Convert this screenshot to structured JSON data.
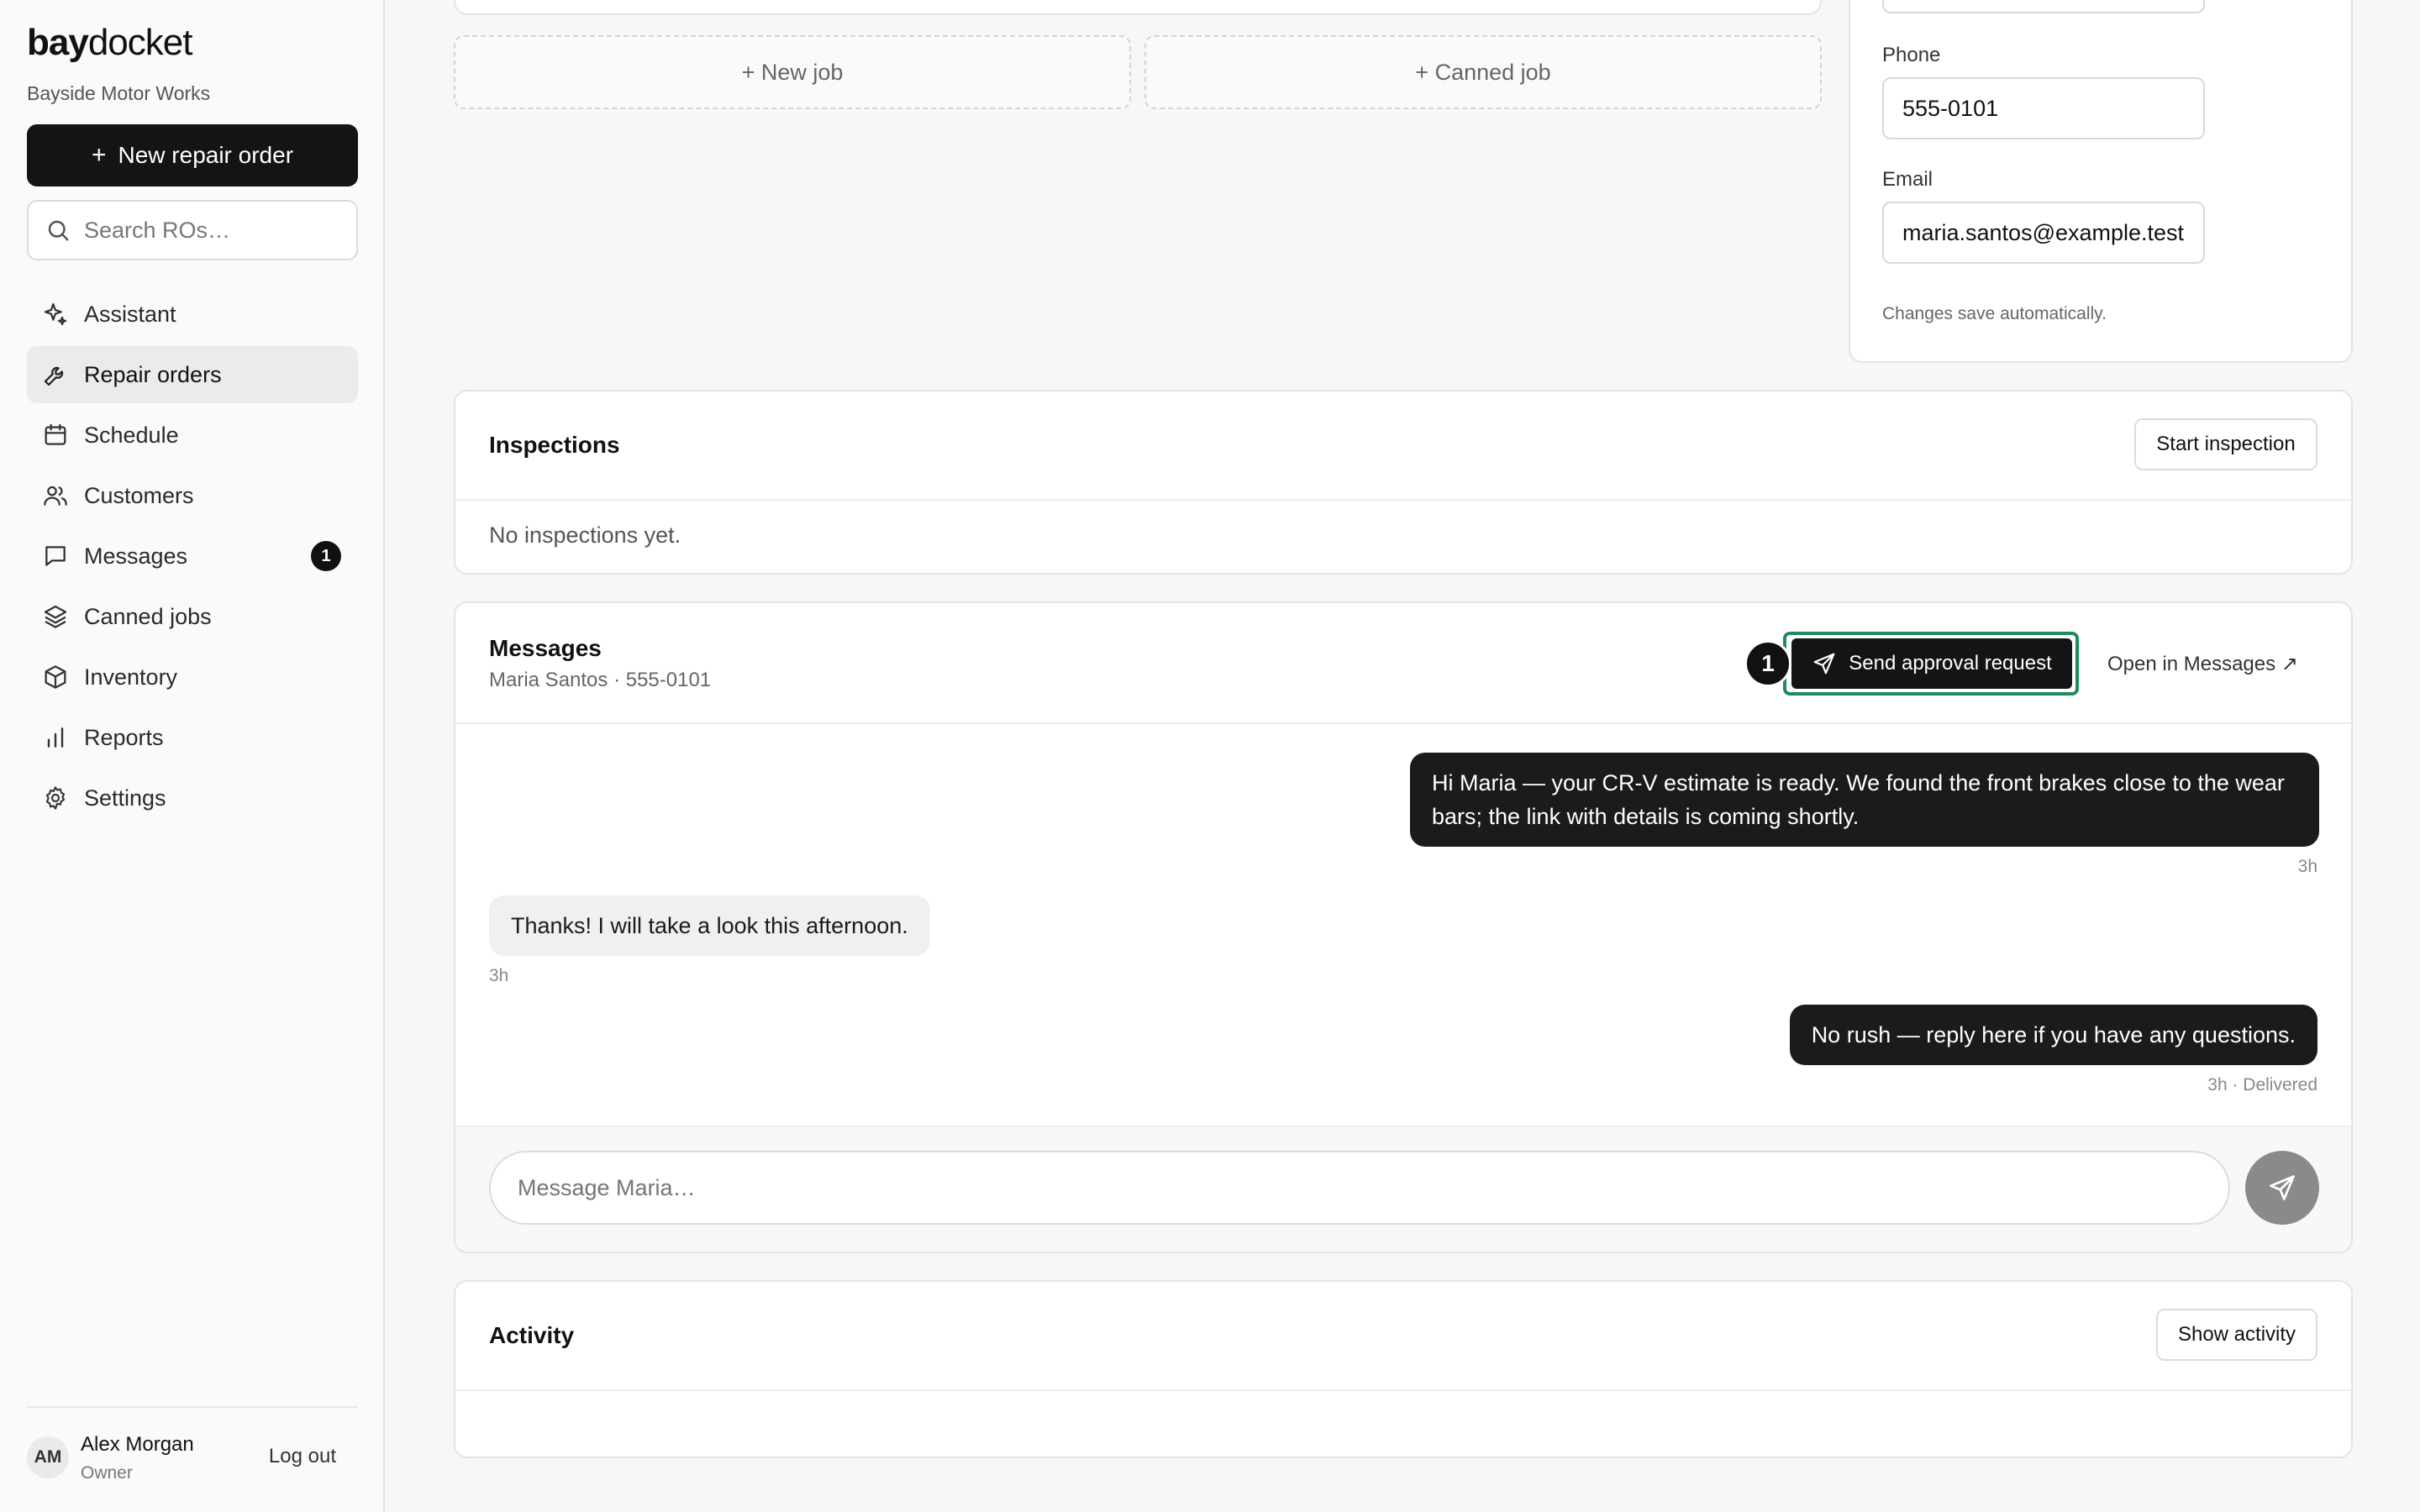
{
  "brand": {
    "logo_bold": "bay",
    "logo_rest": "docket",
    "shop_name": "Bayside Motor Works"
  },
  "sidebar": {
    "new_ro_label": "New repair order",
    "search_placeholder": "Search ROs…",
    "items": [
      {
        "label": "Assistant",
        "icon": "sparkle-icon"
      },
      {
        "label": "Repair orders",
        "icon": "wrench-icon",
        "active": true
      },
      {
        "label": "Schedule",
        "icon": "calendar-icon"
      },
      {
        "label": "Customers",
        "icon": "users-icon"
      },
      {
        "label": "Messages",
        "icon": "chat-icon",
        "badge": "1"
      },
      {
        "label": "Canned jobs",
        "icon": "layers-icon"
      },
      {
        "label": "Inventory",
        "icon": "box-icon"
      },
      {
        "label": "Reports",
        "icon": "bar-chart-icon"
      },
      {
        "label": "Settings",
        "icon": "gear-icon"
      }
    ],
    "user": {
      "initials": "AM",
      "name": "Alex Morgan",
      "role": "Owner",
      "logout_label": "Log out"
    }
  },
  "jobs": {
    "new_job_label": "+ New job",
    "canned_job_label": "+ Canned job"
  },
  "customer": {
    "phone_label": "Phone",
    "phone_value": "555-0101",
    "email_label": "Email",
    "email_value": "maria.santos@example.test",
    "autosave_note": "Changes save automatically."
  },
  "inspections": {
    "title": "Inspections",
    "start_label": "Start inspection",
    "empty_text": "No inspections yet."
  },
  "messages": {
    "title": "Messages",
    "subtitle": "Maria Santos · 555-0101",
    "step_badge": "1",
    "send_approval_label": "Send approval request",
    "open_label": "Open in Messages ↗",
    "thread": [
      {
        "direction": "out",
        "text": "Hi Maria — your CR-V estimate is ready. We found the front brakes close to the wear bars; the link with details is coming shortly.",
        "meta": "3h"
      },
      {
        "direction": "in",
        "text": "Thanks! I will take a look this afternoon.",
        "meta": "3h"
      },
      {
        "direction": "out",
        "text": "No rush — reply here if you have any questions.",
        "meta": "3h · Delivered"
      }
    ],
    "compose_placeholder": "Message Maria…"
  },
  "activity": {
    "title": "Activity",
    "show_label": "Show activity"
  },
  "colors": {
    "accent": "#1f8a5b",
    "dark": "#141414",
    "send_disabled": "#8a8a8a"
  }
}
